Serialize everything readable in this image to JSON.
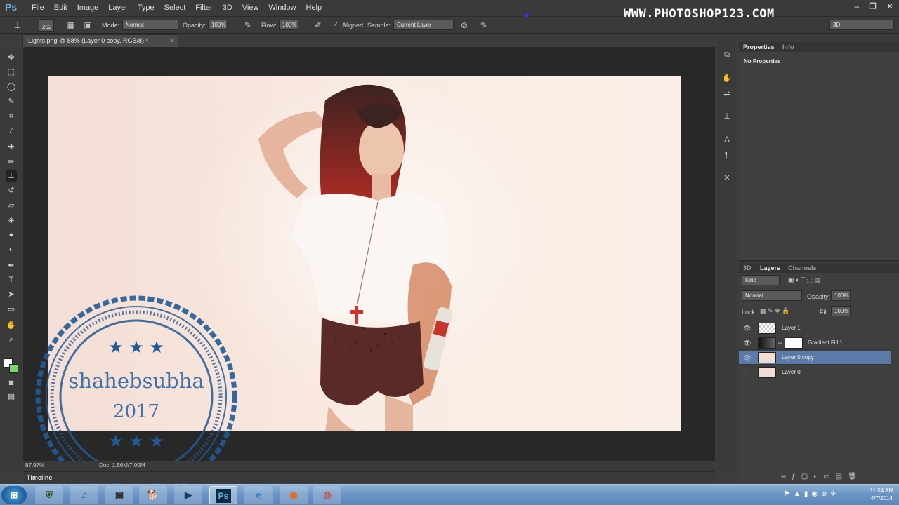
{
  "app": {
    "logo": "Ps",
    "menu": [
      "File",
      "Edit",
      "Image",
      "Layer",
      "Type",
      "Select",
      "Filter",
      "3D",
      "View",
      "Window",
      "Help"
    ],
    "watermark": "WWW.PHOTOSHOP123.COM",
    "window_controls": [
      "–",
      "❐",
      "✕"
    ]
  },
  "options_bar": {
    "brush_size": "202",
    "mode_label": "Mode:",
    "mode_value": "Normal",
    "opacity_label": "Opacity:",
    "opacity_value": "100%",
    "flow_label": "Flow:",
    "flow_value": "100%",
    "aligned_label": "Aligned",
    "sample_label": "Sample:",
    "sample_value": "Current Layer",
    "workspace_value": "3D"
  },
  "document": {
    "tab_title": "Lights.png @ 88% (Layer 0 copy, RGB/8) *",
    "tab_close": "×",
    "zoom": "87.97%",
    "doc_info": "Doc: 1.56M/7.00M"
  },
  "timeline": {
    "label": "Timeline"
  },
  "properties_panel": {
    "tabs": [
      "Properties",
      "Info"
    ],
    "content": "No Properties"
  },
  "layers_panel": {
    "tabs": [
      "3D",
      "Layers",
      "Channels"
    ],
    "filter_kind": "Kind",
    "blend_mode": "Normal",
    "opacity_label": "Opacity:",
    "opacity_value": "100%",
    "lock_label": "Lock:",
    "fill_label": "Fill:",
    "fill_value": "100%",
    "layers": [
      {
        "name": "Layer 1",
        "visible": true,
        "selected": false
      },
      {
        "name": "Gradient Fill 1",
        "visible": true,
        "selected": false
      },
      {
        "name": "Layer 0 copy",
        "visible": true,
        "selected": true
      },
      {
        "name": "Layer 0",
        "visible": false,
        "selected": false
      }
    ]
  },
  "stamp": {
    "text": "shahebsubha",
    "year": "2017",
    "stars": "★ ★ ★"
  },
  "taskbar": {
    "icons": [
      "start-orb",
      "shield-app",
      "itunes",
      "vm-app",
      "dog-app",
      "media-player",
      "Ps",
      "internet-explorer",
      "firefox",
      "chrome"
    ],
    "time": "11:54 AM",
    "date": "4/7/2014"
  },
  "colors": {
    "accent": "#5c7aa8",
    "stamp_blue": "#1f5b98",
    "ps_blue": "#3a6fb0"
  }
}
